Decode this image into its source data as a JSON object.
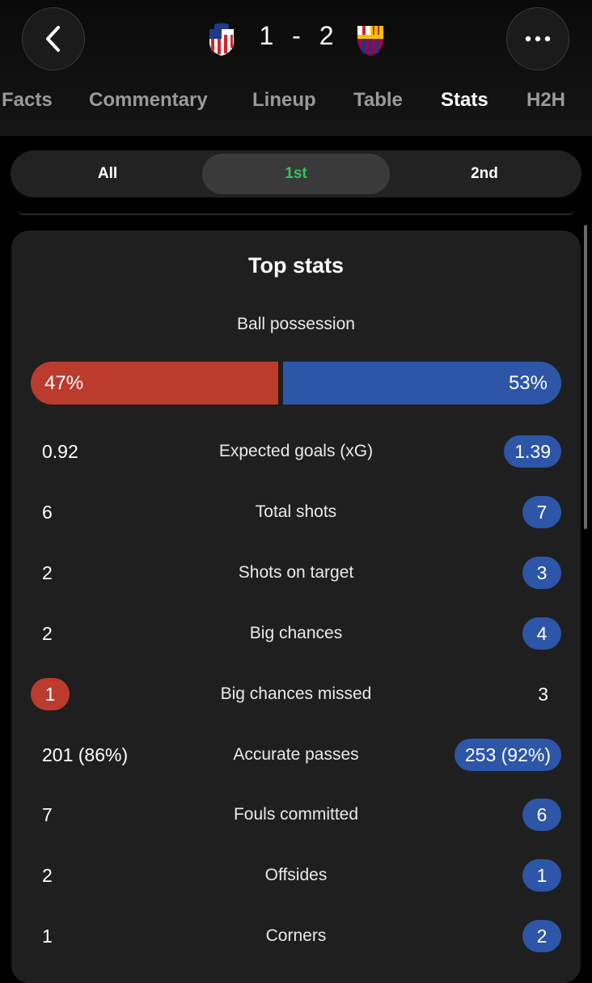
{
  "header": {
    "home_score": "1",
    "separator": "-",
    "away_score": "2",
    "home_crest": "atletico-crest-icon",
    "away_crest": "barcelona-crest-icon"
  },
  "tabs": [
    "Facts",
    "Commentary",
    "Lineup",
    "Table",
    "Stats",
    "H2H"
  ],
  "active_tab": "Stats",
  "period_filter": {
    "options": [
      "All",
      "1st",
      "2nd"
    ],
    "selected": "1st"
  },
  "colors": {
    "home": "#bb3b2d",
    "away": "#2d55a8",
    "selected_period": "#33c35a"
  },
  "top_stats": {
    "title": "Top stats",
    "possession": {
      "label": "Ball possession",
      "home": "47%",
      "away": "53%",
      "home_fraction": 0.47
    },
    "rows": [
      {
        "home": "0.92",
        "label": "Expected goals (xG)",
        "away": "1.39",
        "highlight": "away"
      },
      {
        "home": "6",
        "label": "Total shots",
        "away": "7",
        "highlight": "away"
      },
      {
        "home": "2",
        "label": "Shots on target",
        "away": "3",
        "highlight": "away"
      },
      {
        "home": "2",
        "label": "Big chances",
        "away": "4",
        "highlight": "away"
      },
      {
        "home": "1",
        "label": "Big chances missed",
        "away": "3",
        "highlight": "home"
      },
      {
        "home": "201 (86%)",
        "label": "Accurate passes",
        "away": "253 (92%)",
        "highlight": "away"
      },
      {
        "home": "7",
        "label": "Fouls committed",
        "away": "6",
        "highlight": "away"
      },
      {
        "home": "2",
        "label": "Offsides",
        "away": "1",
        "highlight": "away"
      },
      {
        "home": "1",
        "label": "Corners",
        "away": "2",
        "highlight": "away"
      }
    ]
  }
}
